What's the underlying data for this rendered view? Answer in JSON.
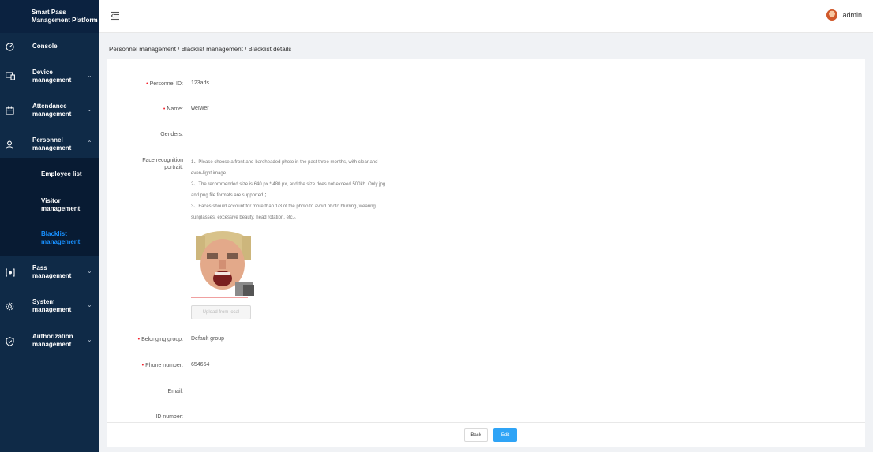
{
  "app": {
    "title_line1": "Smart Pass",
    "title_line2": "Management Platform"
  },
  "sidebar": {
    "items": [
      {
        "label": "Console"
      },
      {
        "label": "Device\nmanagement"
      },
      {
        "label": "Attendance\nmanagement"
      },
      {
        "label": "Personnel\nmanagement"
      },
      {
        "label": "Pass\nmanagement"
      },
      {
        "label": "System\nmanagement"
      },
      {
        "label": "Authorization\nmanagement"
      }
    ],
    "sub_items": [
      {
        "label": "Employee list"
      },
      {
        "label": "Visitor\nmanagement"
      },
      {
        "label": "Blacklist\nmanagement"
      }
    ]
  },
  "header": {
    "user": "admin"
  },
  "breadcrumb": "Personnel management  / Blacklist management  / Blacklist details",
  "form": {
    "personnel_id_label": "Personnel ID:",
    "personnel_id": "123ads",
    "name_label": "Name:",
    "name": "werwer",
    "genders_label": "Genders:",
    "genders": "",
    "face_label_1": "Face recognition",
    "face_label_2": "portrait:",
    "notes": [
      "1、Please choose a front-and-bareheaded photo in the past three months, with clear and",
      "even-light image；",
      "2、The recommended size is 640 px * 480 px, and the size does not exceed 500kb. Only jpg",
      "and png file formats are supported.；",
      "3、Faces should account for more than 1/3 of the photo to avoid photo blurring, wearing",
      "sunglasses, excessive beauty, head rotation, etc.。"
    ],
    "upload_label": "Upload from local",
    "group_label": "Belonging group:",
    "group": "Default group",
    "phone_label": "Phone number:",
    "phone": "654654",
    "email_label": "Email:",
    "email": "",
    "id_number_label": "ID number:",
    "id_number": ""
  },
  "footer": {
    "back_label": "Back",
    "edit_label": "Edit"
  },
  "colors": {
    "sidebar_bg": "#0f2a47",
    "active_link": "#1890ff",
    "primary_button": "#2fa4f6",
    "required_mark": "#f5222d"
  }
}
